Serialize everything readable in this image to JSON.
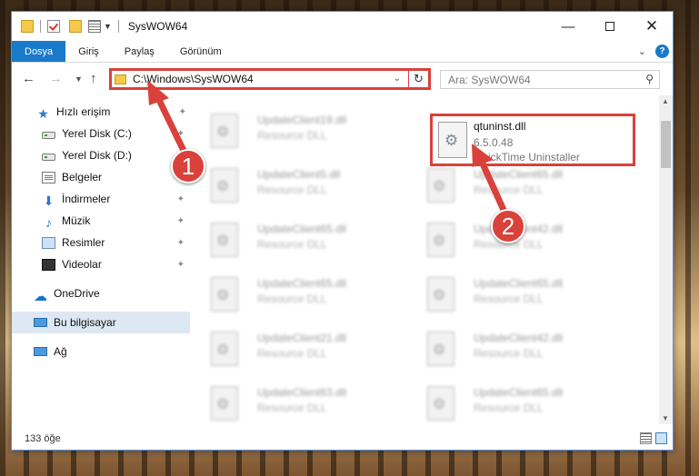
{
  "title": "SysWOW64",
  "ribbon": {
    "tabs": [
      "Dosya",
      "Giriş",
      "Paylaş",
      "Görünüm"
    ],
    "help_label": "?"
  },
  "address": {
    "path": "C:\\Windows\\SysWOW64",
    "search_placeholder": "Ara: SysWOW64"
  },
  "nav": {
    "quick_access": "Hızlı erişim",
    "items": [
      {
        "label": "Yerel Disk (C:)",
        "icon": "disk-icon",
        "pinned": true
      },
      {
        "label": "Yerel Disk (D:)",
        "icon": "disk-icon",
        "pinned": false
      },
      {
        "label": "Belgeler",
        "icon": "documents-icon",
        "pinned": true
      },
      {
        "label": "İndirmeler",
        "icon": "download-icon",
        "pinned": true
      },
      {
        "label": "Müzik",
        "icon": "music-icon",
        "pinned": true
      },
      {
        "label": "Resimler",
        "icon": "pictures-icon",
        "pinned": true
      },
      {
        "label": "Videolar",
        "icon": "video-icon",
        "pinned": true
      }
    ],
    "onedrive": "OneDrive",
    "this_pc": "Bu bilgisayar",
    "network": "Ağ"
  },
  "files": {
    "left": [
      {
        "name": "UpdateClient19.dll",
        "type": "Resource DLL"
      },
      {
        "name": "UpdateClient5.dll",
        "type": "Resource DLL"
      },
      {
        "name": "UpdateClient65.dll",
        "type": "Resource DLL"
      },
      {
        "name": "UpdateClient65.dll",
        "type": "Resource DLL"
      },
      {
        "name": "UpdateClient21.dll",
        "type": "Resource DLL"
      },
      {
        "name": "UpdateClient63.dll",
        "type": "Resource DLL"
      }
    ],
    "right": [
      {
        "name": "UpdateClient65.dll",
        "type": "Resource DLL"
      },
      {
        "name": "UpdateClient42.dll",
        "type": "Resource DLL"
      },
      {
        "name": "UpdateClient65.dll",
        "type": "Resource DLL"
      },
      {
        "name": "UpdateClient42.dll",
        "type": "Resource DLL"
      },
      {
        "name": "UpdateClient65.dll",
        "type": "Resource DLL"
      }
    ],
    "highlighted": {
      "name": "qtuninst.dll",
      "version": "6.5.0.48",
      "description": "QuickTime Uninstaller"
    }
  },
  "status": {
    "item_count": "133 öğe"
  },
  "callouts": [
    "1",
    "2"
  ],
  "colors": {
    "accent": "#1979ca",
    "highlight": "#d9413a"
  }
}
